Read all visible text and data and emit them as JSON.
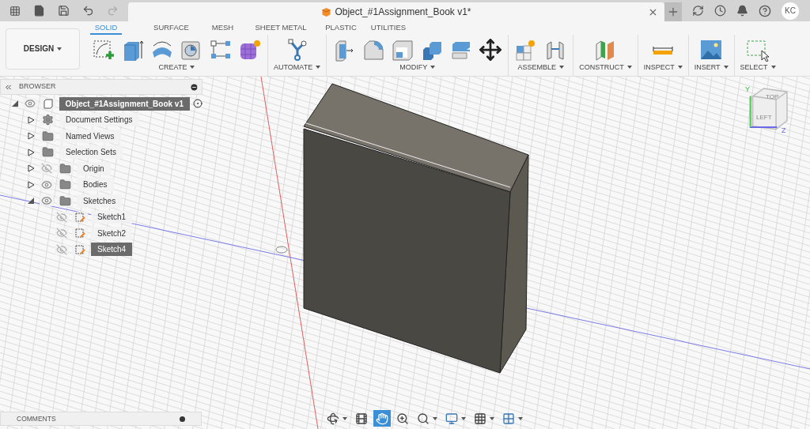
{
  "document": {
    "title": "Object_#1Assignment_Book v1*",
    "user_initials": "KC"
  },
  "workspace": {
    "label": "DESIGN"
  },
  "tabs": [
    {
      "label": "SOLID",
      "selected": true
    },
    {
      "label": "SURFACE",
      "selected": false
    },
    {
      "label": "MESH",
      "selected": false
    },
    {
      "label": "SHEET METAL",
      "selected": false
    },
    {
      "label": "PLASTIC",
      "selected": false
    },
    {
      "label": "UTILITIES",
      "selected": false
    }
  ],
  "tool_groups": [
    {
      "label": "CREATE",
      "tools": [
        {
          "kind": "sketch"
        },
        {
          "kind": "extrude"
        },
        {
          "kind": "revolve"
        },
        {
          "kind": "hole"
        },
        {
          "kind": "pattern"
        },
        {
          "kind": "form"
        }
      ]
    },
    {
      "label": "AUTOMATE",
      "tools": [
        {
          "kind": "automate"
        }
      ]
    },
    {
      "label": "MODIFY",
      "tools": [
        {
          "kind": "presspull"
        },
        {
          "kind": "fillet"
        },
        {
          "kind": "shell"
        },
        {
          "kind": "combine"
        },
        {
          "kind": "replace"
        },
        {
          "kind": "move"
        }
      ]
    },
    {
      "label": "ASSEMBLE",
      "tools": [
        {
          "kind": "component"
        },
        {
          "kind": "joint"
        }
      ]
    },
    {
      "label": "CONSTRUCT",
      "tools": [
        {
          "kind": "plane"
        }
      ]
    },
    {
      "label": "INSPECT",
      "tools": [
        {
          "kind": "measure"
        }
      ]
    },
    {
      "label": "INSERT",
      "tools": [
        {
          "kind": "image"
        }
      ]
    },
    {
      "label": "SELECT",
      "tools": [
        {
          "kind": "select"
        }
      ]
    }
  ],
  "browser": {
    "title": "BROWSER",
    "tree": [
      {
        "kind": "component",
        "label": "Object_#1Assignment_Book v1",
        "visible": true,
        "expanded": true,
        "selected": true,
        "children": [
          {
            "kind": "settings",
            "label": "Document Settings",
            "expanded": false,
            "selected": false
          },
          {
            "kind": "folder",
            "label": "Named Views",
            "expanded": false,
            "selected": false
          },
          {
            "kind": "folder",
            "label": "Selection Sets",
            "expanded": false,
            "selected": false
          },
          {
            "kind": "folder",
            "label": "Origin",
            "visible": false,
            "expanded": false,
            "selected": false
          },
          {
            "kind": "folder",
            "label": "Bodies",
            "visible": true,
            "expanded": false,
            "selected": false
          },
          {
            "kind": "folder",
            "label": "Sketches",
            "visible": true,
            "expanded": true,
            "selected": false,
            "children": [
              {
                "kind": "sketch",
                "label": "Sketch1",
                "visible": false,
                "selected": false
              },
              {
                "kind": "sketch",
                "label": "Sketch2",
                "visible": false,
                "selected": false
              },
              {
                "kind": "sketch",
                "label": "Sketch4",
                "visible": false,
                "selected": true
              }
            ]
          }
        ]
      }
    ]
  },
  "view_cube": {
    "top": "TOP",
    "left": "LEFT",
    "y_axis": "Y",
    "z_axis": "Z"
  },
  "comments": {
    "title": "COMMENTS"
  },
  "nav_tools": [
    {
      "kind": "orbit",
      "selected": false
    },
    {
      "kind": "look",
      "selected": false
    },
    {
      "kind": "pan",
      "selected": true
    },
    {
      "kind": "zoom",
      "selected": false
    },
    {
      "kind": "fit",
      "selected": false
    },
    {
      "kind": "display",
      "selected": false
    },
    {
      "kind": "grid",
      "selected": false
    },
    {
      "kind": "viewports",
      "selected": false
    }
  ]
}
